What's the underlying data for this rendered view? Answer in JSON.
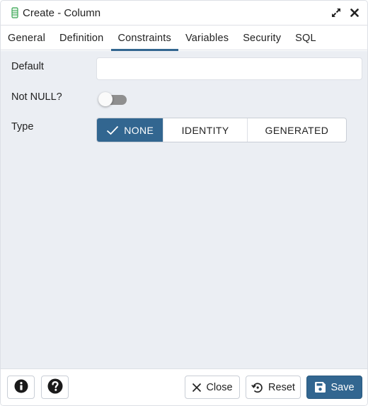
{
  "window": {
    "title": "Create - Column",
    "icon": "column-icon",
    "actions": [
      {
        "name": "maximize",
        "icon": "expand-icon"
      },
      {
        "name": "close",
        "icon": "close-icon"
      }
    ]
  },
  "tabs": [
    {
      "label": "General",
      "active": false
    },
    {
      "label": "Definition",
      "active": false
    },
    {
      "label": "Constraints",
      "active": true
    },
    {
      "label": "Variables",
      "active": false
    },
    {
      "label": "Security",
      "active": false
    },
    {
      "label": "SQL",
      "active": false
    }
  ],
  "form": {
    "default": {
      "label": "Default",
      "value": "",
      "placeholder": ""
    },
    "not_null": {
      "label": "Not NULL?",
      "checked": false
    },
    "type": {
      "label": "Type",
      "options": [
        "NONE",
        "IDENTITY",
        "GENERATED"
      ],
      "selected": "NONE"
    }
  },
  "footer": {
    "info_icon": "info-icon",
    "help_icon": "help-icon",
    "close_label": "Close",
    "reset_label": "Reset",
    "save_label": "Save"
  },
  "colors": {
    "accent": "#326690",
    "content_bg": "#ebeef3",
    "toggle_off": "#8f8f8f"
  }
}
